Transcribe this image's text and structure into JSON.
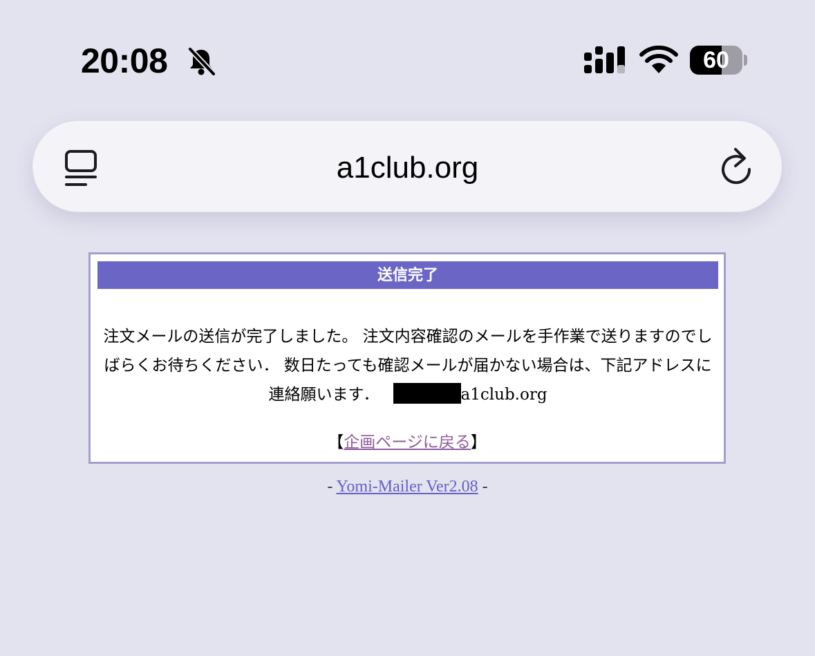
{
  "status_bar": {
    "time": "20:08",
    "silent_icon": "bell-slash-icon",
    "signal_icon": "cellular-signal-icon",
    "wifi_icon": "wifi-icon",
    "battery_level": "60",
    "battery_fraction": 0.6
  },
  "address_bar": {
    "url": "a1club.org",
    "left_icon": "reader-mode-icon",
    "right_icon": "reload-icon"
  },
  "panel": {
    "header": "送信完了",
    "message": "注文メールの送信が完了しました。 注文内容確認のメールを手作業で送りますのでしばらくお待ちください． 数日たっても確認メールが届かない場合は、下記アドレスに連絡願います．",
    "email_domain": "a1club.org",
    "back_bracket_open": "【",
    "back_link": "企画ページに戻る",
    "back_bracket_close": "】"
  },
  "footer": {
    "prefix": "- ",
    "link": "Yomi-Mailer Ver2.08",
    "suffix": " -"
  },
  "colors": {
    "page_background": "#e3e2ef",
    "header_background": "#6b66c6",
    "panel_border": "#a29fcf",
    "back_link": "#8d5b9a",
    "footer_link": "#6660c4"
  }
}
